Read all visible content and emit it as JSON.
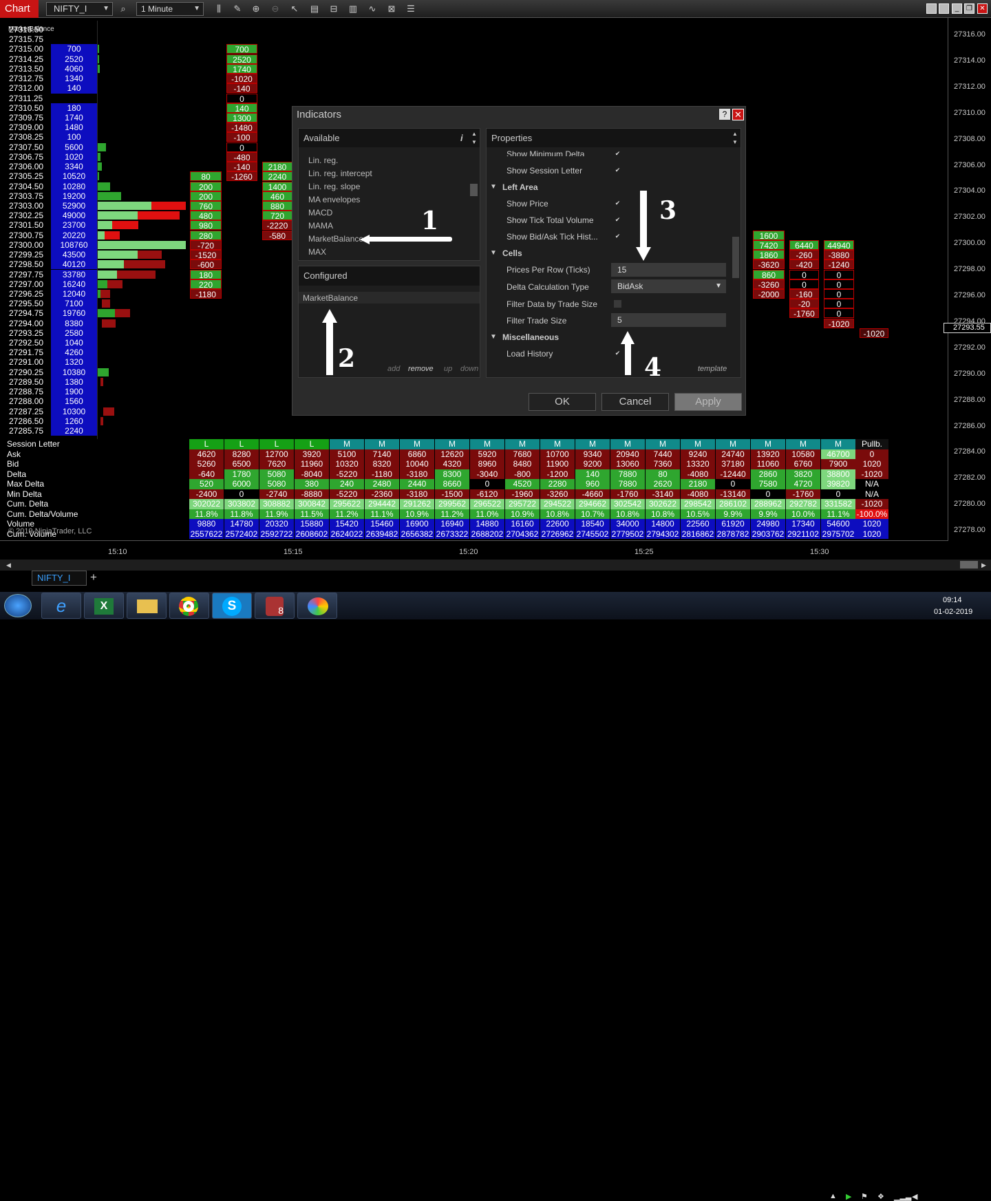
{
  "toolbar": {
    "chart_tab": "Chart",
    "instrument": "NIFTY_I",
    "interval": "1 Minute"
  },
  "indicator_label": "MarketBalance",
  "price_axis": [
    "27316.00",
    "27314.00",
    "27312.00",
    "27310.00",
    "27308.00",
    "27306.00",
    "27304.00",
    "27302.00",
    "27300.00",
    "27298.00",
    "27296.00",
    "27294.00",
    "27292.00",
    "27290.00",
    "27288.00",
    "27286.00",
    "27284.00",
    "27282.00",
    "27280.00",
    "27278.00"
  ],
  "current_price": "27293.55",
  "time_axis": [
    "15:10",
    "15:15",
    "15:20",
    "15:25",
    "15:30"
  ],
  "profile": {
    "prices": [
      "27316.50",
      "27315.75",
      "27315.00",
      "27314.25",
      "27313.50",
      "27312.75",
      "27312.00",
      "27311.25",
      "27310.50",
      "27309.75",
      "27309.00",
      "27308.25",
      "27307.50",
      "27306.75",
      "27306.00",
      "27305.25",
      "27304.50",
      "27303.75",
      "27303.00",
      "27302.25",
      "27301.50",
      "27300.75",
      "27300.00",
      "27299.25",
      "27298.50",
      "27297.75",
      "27297.00",
      "27296.25",
      "27295.50",
      "27294.75",
      "27294.00",
      "27293.25",
      "27292.50",
      "27291.75",
      "27291.00",
      "27290.25",
      "27289.50",
      "27288.75",
      "27288.00",
      "27287.25",
      "27286.50",
      "27285.75"
    ],
    "volumes": [
      "",
      "",
      "700",
      "2520",
      "4060",
      "1340",
      "140",
      "",
      "180",
      "1740",
      "1480",
      "100",
      "5600",
      "1020",
      "3340",
      "10520",
      "10280",
      "19200",
      "52900",
      "49000",
      "23700",
      "20220",
      "108760",
      "43500",
      "40120",
      "33780",
      "16240",
      "12040",
      "7100",
      "19760",
      "8380",
      "2580",
      "1040",
      "4260",
      "1320",
      "10380",
      "1380",
      "1900",
      "1560",
      "10300",
      "1260",
      "2240"
    ]
  },
  "col1": {
    "values": [
      "80",
      "200",
      "200",
      "760",
      "480",
      "980",
      "280",
      "-720",
      "-1520",
      "-600",
      "180",
      "220",
      "-1180"
    ]
  },
  "col2": {
    "values": [
      "700",
      "2520",
      "1740",
      "-1020",
      "-140",
      "0",
      "140",
      "1300",
      "-1480",
      "-100",
      "0",
      "-480",
      "-140",
      "-1260"
    ]
  },
  "col3": {
    "values": [
      "2180",
      "2240",
      "1400",
      "460",
      "880",
      "720",
      "-2220",
      "-580"
    ]
  },
  "col4": {
    "values": [
      "1600",
      "7420",
      "1860",
      "-3620",
      "860",
      "-3260",
      "-2000"
    ]
  },
  "col5": {
    "values": [
      "6440",
      "-260",
      "-420",
      "0",
      "0",
      "-160",
      "-20",
      "-1760"
    ]
  },
  "col6": {
    "values": [
      "44940",
      "-3880",
      "-1240",
      "0",
      "0",
      "0",
      "0",
      "0",
      "-1020"
    ]
  },
  "col7": {
    "value": "-1020"
  },
  "stats": {
    "labels": [
      "Session Letter",
      "Ask",
      "Bid",
      "Delta",
      "Max Delta",
      "Min Delta",
      "Cum. Delta",
      "Cum. Delta/Volume",
      "Volume",
      "Cum. Volume"
    ],
    "session": [
      "L",
      "L",
      "L",
      "L",
      "M",
      "M",
      "M",
      "M",
      "M",
      "M",
      "M",
      "M",
      "M",
      "M",
      "M",
      "M",
      "M",
      "M",
      "M",
      "Pullb."
    ],
    "ask": [
      "4620",
      "8280",
      "12700",
      "3920",
      "5100",
      "7140",
      "6860",
      "12620",
      "5920",
      "7680",
      "10700",
      "9340",
      "20940",
      "7440",
      "9240",
      "24740",
      "13920",
      "10580",
      "46700",
      "0"
    ],
    "bid": [
      "5260",
      "6500",
      "7620",
      "11960",
      "10320",
      "8320",
      "10040",
      "4320",
      "8960",
      "8480",
      "11900",
      "9200",
      "13060",
      "7360",
      "13320",
      "37180",
      "11060",
      "6760",
      "7900",
      "1020"
    ],
    "delta": [
      "-640",
      "1780",
      "5080",
      "-8040",
      "-5220",
      "-1180",
      "-3180",
      "8300",
      "-3040",
      "-800",
      "-1200",
      "140",
      "7880",
      "80",
      "-4080",
      "-12440",
      "2860",
      "3820",
      "38800",
      "-1020"
    ],
    "max_delta": [
      "520",
      "6000",
      "5080",
      "380",
      "240",
      "2480",
      "2440",
      "8660",
      "0",
      "4520",
      "2280",
      "960",
      "7880",
      "2620",
      "2180",
      "0",
      "7580",
      "4720",
      "39820",
      "N/A"
    ],
    "min_delta": [
      "-2400",
      "0",
      "-2740",
      "-8880",
      "-5220",
      "-2360",
      "-3180",
      "-1500",
      "-6120",
      "-1960",
      "-3260",
      "-4660",
      "-1760",
      "-3140",
      "-4080",
      "-13140",
      "0",
      "-1760",
      "0",
      "N/A"
    ],
    "cum_delta": [
      "302022",
      "303802",
      "308882",
      "300842",
      "295622",
      "294442",
      "291262",
      "299562",
      "296522",
      "295722",
      "294522",
      "294662",
      "302542",
      "302622",
      "298542",
      "286102",
      "288962",
      "292782",
      "331582",
      "-1020"
    ],
    "cum_delta_vol": [
      "11.8%",
      "11.8%",
      "11.9%",
      "11.5%",
      "11.2%",
      "11.1%",
      "10.9%",
      "11.2%",
      "11.0%",
      "10.9%",
      "10.8%",
      "10.7%",
      "10.8%",
      "10.8%",
      "10.5%",
      "9.9%",
      "9.9%",
      "10.0%",
      "11.1%",
      "-100.0%"
    ],
    "volume": [
      "9880",
      "14780",
      "20320",
      "15880",
      "15420",
      "15460",
      "16900",
      "16940",
      "14880",
      "16160",
      "22600",
      "18540",
      "34000",
      "14800",
      "22560",
      "61920",
      "24980",
      "17340",
      "54600",
      "1020"
    ],
    "cum_volume": [
      "2557622",
      "2572402",
      "2592722",
      "2608602",
      "2624022",
      "2639482",
      "2656382",
      "2673322",
      "2688202",
      "2704362",
      "2726962",
      "2745502",
      "2779502",
      "2794302",
      "2816862",
      "2878782",
      "2903762",
      "2921102",
      "2975702",
      "1020"
    ]
  },
  "copyright": "© 2019 NinjaTrader, LLC",
  "bottom_tab": "NIFTY_I",
  "dialog": {
    "title": "Indicators",
    "available_header": "Available",
    "available": [
      "Lin. reg.",
      "Lin. reg. intercept",
      "Lin. reg. slope",
      "MA envelopes",
      "MACD",
      "MAMA",
      "MarketBalance",
      "MAX"
    ],
    "configured_header": "Configured",
    "configured": [
      "MarketBalance"
    ],
    "list_actions": [
      "add",
      "remove",
      "up",
      "down"
    ],
    "properties_header": "Properties",
    "props": {
      "show_min_delta": "Show Minimum Delta",
      "show_session_letter": "Show Session Letter",
      "left_area": "Left Area",
      "show_price": "Show Price",
      "show_tick_total_volume": "Show Tick Total Volume",
      "show_bid_ask_hist": "Show Bid/Ask Tick Hist...",
      "cells": "Cells",
      "prices_per_row": "Prices Per Row (Ticks)",
      "prices_per_row_val": "15",
      "delta_calc": "Delta Calculation Type",
      "delta_calc_val": "BidAsk",
      "filter_data": "Filter Data by Trade Size",
      "filter_size": "Filter Trade Size",
      "filter_size_val": "5",
      "misc": "Miscellaneous",
      "load_history": "Load History"
    },
    "template": "template",
    "ok": "OK",
    "cancel": "Cancel",
    "apply": "Apply"
  },
  "annotations": [
    "1",
    "2",
    "3",
    "4"
  ],
  "taskbar": {
    "time": "09:14",
    "date": "01-02-2019"
  }
}
